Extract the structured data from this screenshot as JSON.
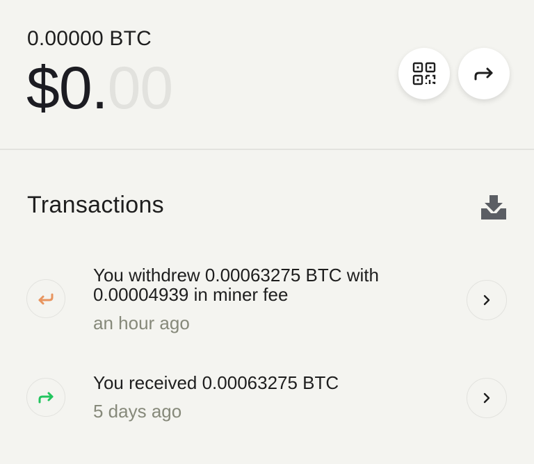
{
  "balance": {
    "btc": "0.00000 BTC",
    "fiat_main": "$0.",
    "fiat_cents": "00"
  },
  "actions": {
    "receive_icon": "qr-code-icon",
    "send_icon": "send-arrow-icon"
  },
  "transactions": {
    "title": "Transactions",
    "export_icon": "download-tray-icon",
    "items": [
      {
        "direction": "withdraw",
        "icon": "return-arrow-icon",
        "icon_color": "#e8955f",
        "line1": "You withdrew 0.00063275 BTC with",
        "line2": "0.00004939 in miner fee",
        "time": "an hour ago"
      },
      {
        "direction": "receive",
        "icon": "forward-arrow-icon",
        "icon_color": "#22c55e",
        "line1": "You received 0.00063275 BTC",
        "time": "5 days ago"
      }
    ]
  }
}
